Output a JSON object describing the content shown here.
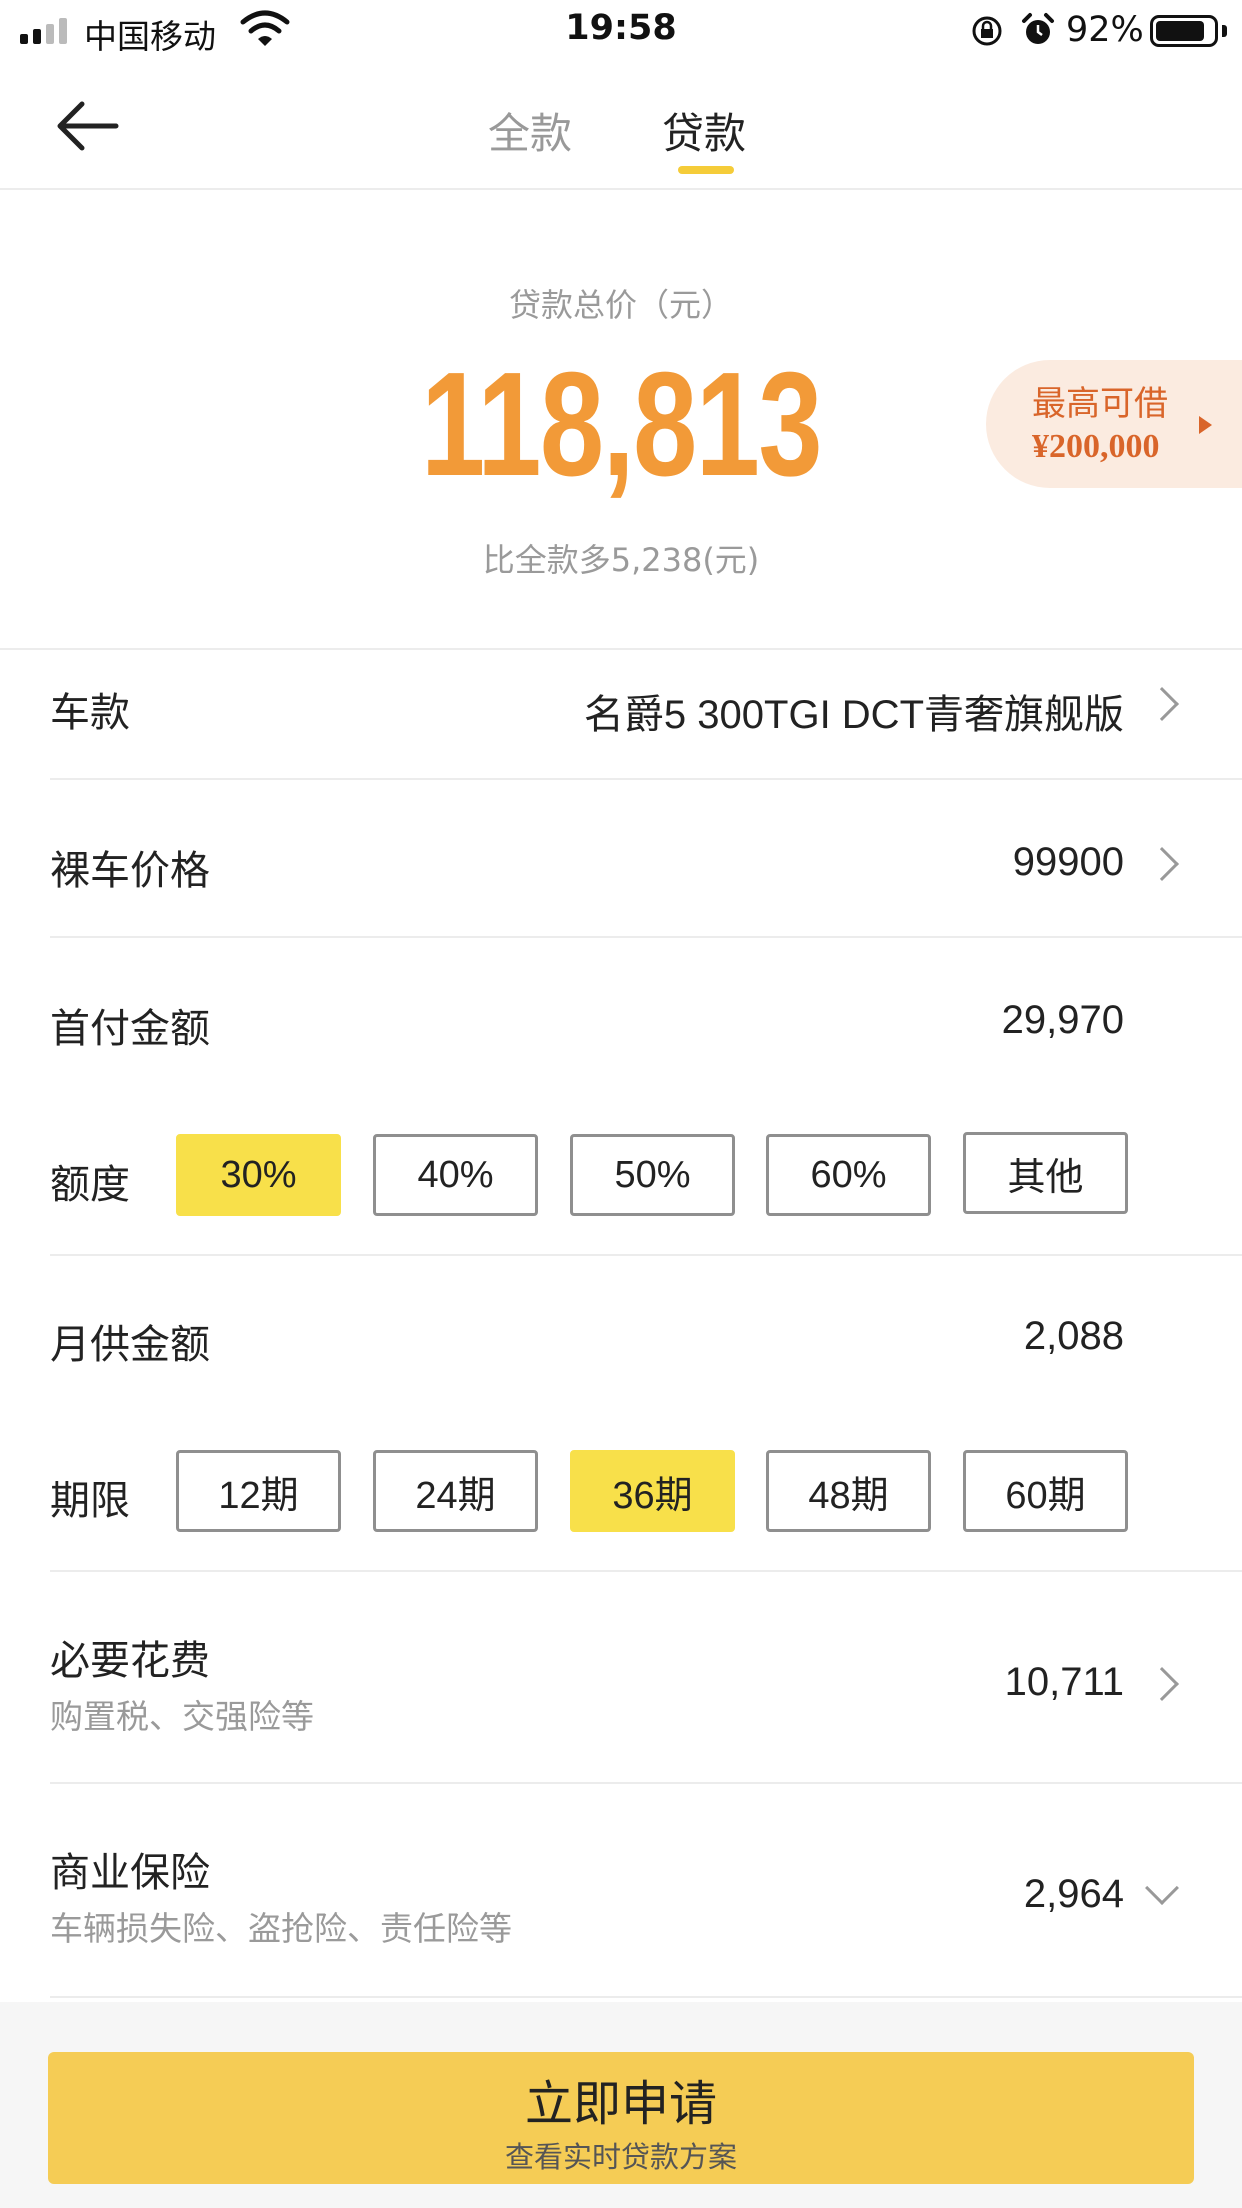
{
  "status_bar": {
    "carrier": "中国移动",
    "time": "19:58",
    "battery": "92%"
  },
  "nav": {
    "tabs": [
      {
        "label": "全款",
        "active": false
      },
      {
        "label": "贷款",
        "active": true
      }
    ],
    "back_icon": "arrow-left-icon"
  },
  "summary": {
    "label": "贷款总价（元）",
    "total": "118,813",
    "diff": "比全款多5,238(元)",
    "max_borrow_label": "最高可借",
    "max_borrow_value": "¥200,000"
  },
  "rows": {
    "model": {
      "label": "车款",
      "value": "名爵5 300TGI DCT青奢旗舰版"
    },
    "price": {
      "label": "裸车价格",
      "value": "99900"
    },
    "down_payment": {
      "label": "首付金额",
      "value": "29,970"
    },
    "ratio": {
      "label": "额度",
      "options": [
        "30%",
        "40%",
        "50%",
        "60%",
        "其他"
      ],
      "selected": "30%"
    },
    "monthly": {
      "label": "月供金额",
      "value": "2,088"
    },
    "term": {
      "label": "期限",
      "options": [
        "12期",
        "24期",
        "36期",
        "48期",
        "60期"
      ],
      "selected": "36期"
    },
    "fees": {
      "label": "必要花费",
      "sub": "购置税、交强险等",
      "value": "10,711"
    },
    "insurance": {
      "label": "商业保险",
      "sub": "车辆损失险、盗抢险、责任险等",
      "value": "2,964"
    }
  },
  "apply": {
    "title": "立即申请",
    "subtitle": "查看实时贷款方案"
  },
  "colors": {
    "accent": "#f29a38",
    "highlight": "#f8e04a",
    "button": "#f5cc55",
    "tab_indicator": "#f5cc39"
  }
}
